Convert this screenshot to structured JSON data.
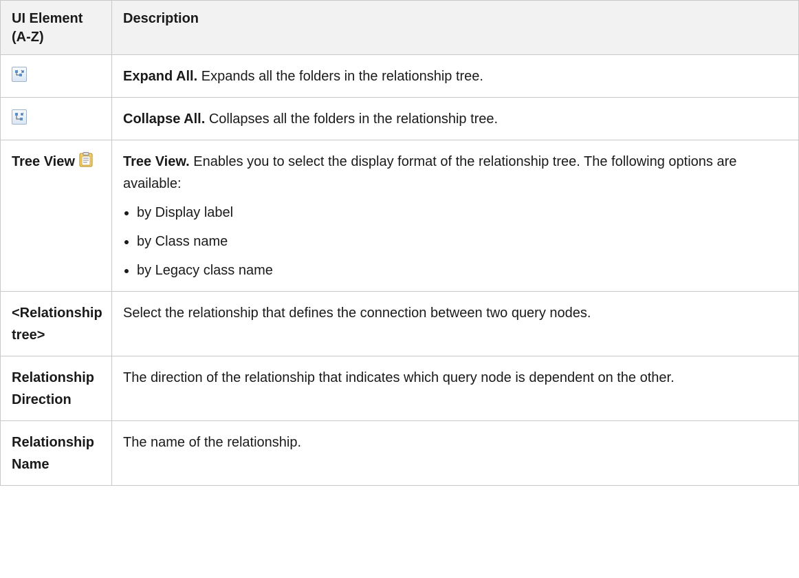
{
  "table": {
    "headers": [
      "UI Element (A-Z)",
      "Description"
    ],
    "rows": {
      "expand": {
        "icon": "expand-all-icon",
        "title": "Expand All.",
        "text": " Expands all the folders in the relationship tree."
      },
      "collapse": {
        "icon": "collapse-all-icon",
        "title": "Collapse All.",
        "text": " Collapses all the folders in the relationship tree."
      },
      "treeview": {
        "element": "Tree View",
        "icon": "tree-view-icon",
        "title": "Tree View.",
        "text": " Enables you to select the display format of the relationship tree. The following options are available:",
        "options": [
          "by Display label",
          "by Class name",
          "by Legacy class name"
        ]
      },
      "reltree": {
        "element": "<Relationship tree>",
        "text": "Select the relationship that defines the connection between two query nodes."
      },
      "reldir": {
        "element": "Relationship Direction",
        "text": "The direction of the relationship that indicates which query node is dependent on the other."
      },
      "relname": {
        "element": "Relationship Name",
        "text": "The name of the relationship."
      }
    }
  }
}
